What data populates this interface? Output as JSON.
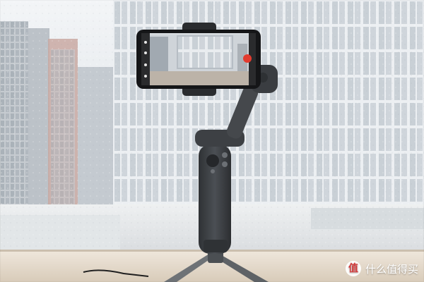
{
  "watermark": {
    "logo_glyph": "值",
    "text": "什么值得买"
  },
  "colors": {
    "sky": "#dfe5ea",
    "building_light": "#e9ecef",
    "building_grid": "#b8c0c8",
    "gimbal_body": "#3f4246",
    "gimbal_dark": "#2b2d30",
    "record_button": "#e23b2f",
    "floor_ledge": "#e7ddd0"
  },
  "icons": [
    "gimbal-mount-icon",
    "phone-camera-record-icon"
  ]
}
